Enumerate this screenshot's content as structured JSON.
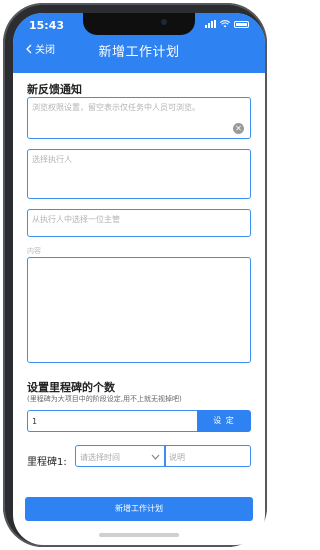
{
  "status_bar": {
    "time": "15:43"
  },
  "header": {
    "back_label": "关闭",
    "title": "新增工作计划"
  },
  "notice": {
    "title": "新反馈通知",
    "visibility_placeholder": "浏览权限设置，留空表示仅任务中人员可浏览。",
    "executor_placeholder": "选择执行人",
    "supervisor_placeholder": "从执行人中选择一位主管",
    "content_label": "内容"
  },
  "milestones": {
    "title": "设置里程碑的个数",
    "hint": "(里程碑为大项目中的阶段设定,用不上就无视掉吧)",
    "count_value": "1",
    "set_button": "设 定",
    "row_label": "里程碑1:",
    "time_placeholder": "请选择时间",
    "desc_placeholder": "说明"
  },
  "submit_label": "新增工作计划",
  "colors": {
    "accent": "#2e82f2",
    "border": "#3d8ef0"
  }
}
